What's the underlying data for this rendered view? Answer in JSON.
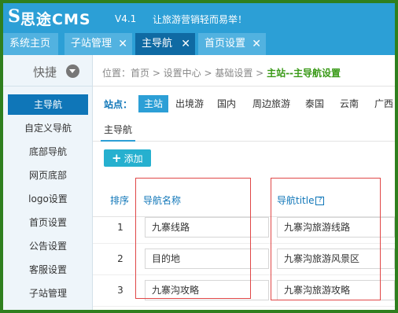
{
  "app": {
    "logo_mark": "S",
    "logo_text": "思途CMS",
    "version": "V4.1",
    "slogan": "让旅游营销轻而易举！"
  },
  "tabs": [
    {
      "label": "系统主页",
      "closable": false,
      "active": false
    },
    {
      "label": "子站管理",
      "closable": true,
      "active": false
    },
    {
      "label": "主导航",
      "closable": true,
      "active": true
    },
    {
      "label": "首页设置",
      "closable": true,
      "active": false
    }
  ],
  "sidebar": {
    "header_label": "快捷",
    "header_icon": "chevron-down-circle-icon",
    "items": [
      {
        "label": "主导航",
        "active": true
      },
      {
        "label": "自定义导航",
        "active": false
      },
      {
        "label": "底部导航",
        "active": false
      },
      {
        "label": "网页底部",
        "active": false
      },
      {
        "label": "logo设置",
        "active": false
      },
      {
        "label": "首页设置",
        "active": false
      },
      {
        "label": "公告设置",
        "active": false
      },
      {
        "label": "客服设置",
        "active": false
      },
      {
        "label": "子站管理",
        "active": false
      }
    ]
  },
  "breadcrumb": {
    "path": "位置：首页 > 设置中心 > 基础设置 > ",
    "current": "主站--主导航设置"
  },
  "stations": {
    "label": "站点：",
    "items": [
      {
        "label": "主站",
        "active": true
      },
      {
        "label": "出境游",
        "active": false
      },
      {
        "label": "国内",
        "active": false
      },
      {
        "label": "周边旅游",
        "active": false
      },
      {
        "label": "泰国",
        "active": false
      },
      {
        "label": "云南",
        "active": false
      },
      {
        "label": "广西",
        "active": false
      }
    ]
  },
  "subtab": {
    "label": "主导航"
  },
  "add_button": {
    "label": "添加",
    "icon": "plus-icon"
  },
  "table": {
    "headers": {
      "order": "排序",
      "name": "导航名称",
      "title": "导航title",
      "help_icon": "?"
    },
    "rows": [
      {
        "order": "1",
        "name": "九寨线路",
        "title": "九寨沟旅游线路"
      },
      {
        "order": "2",
        "name": "目的地",
        "title": "九寨沟旅游风景区"
      },
      {
        "order": "3",
        "name": "九寨沟攻略",
        "title": "九寨沟旅游攻略"
      }
    ]
  },
  "colors": {
    "header_blue": "#2c9fd6",
    "active_blue": "#0f76b8",
    "frame_green": "#2f7f1e",
    "breadcrumb_green": "#3a9a18",
    "add_button": "#26b0cf",
    "highlight_red": "#e04747"
  }
}
